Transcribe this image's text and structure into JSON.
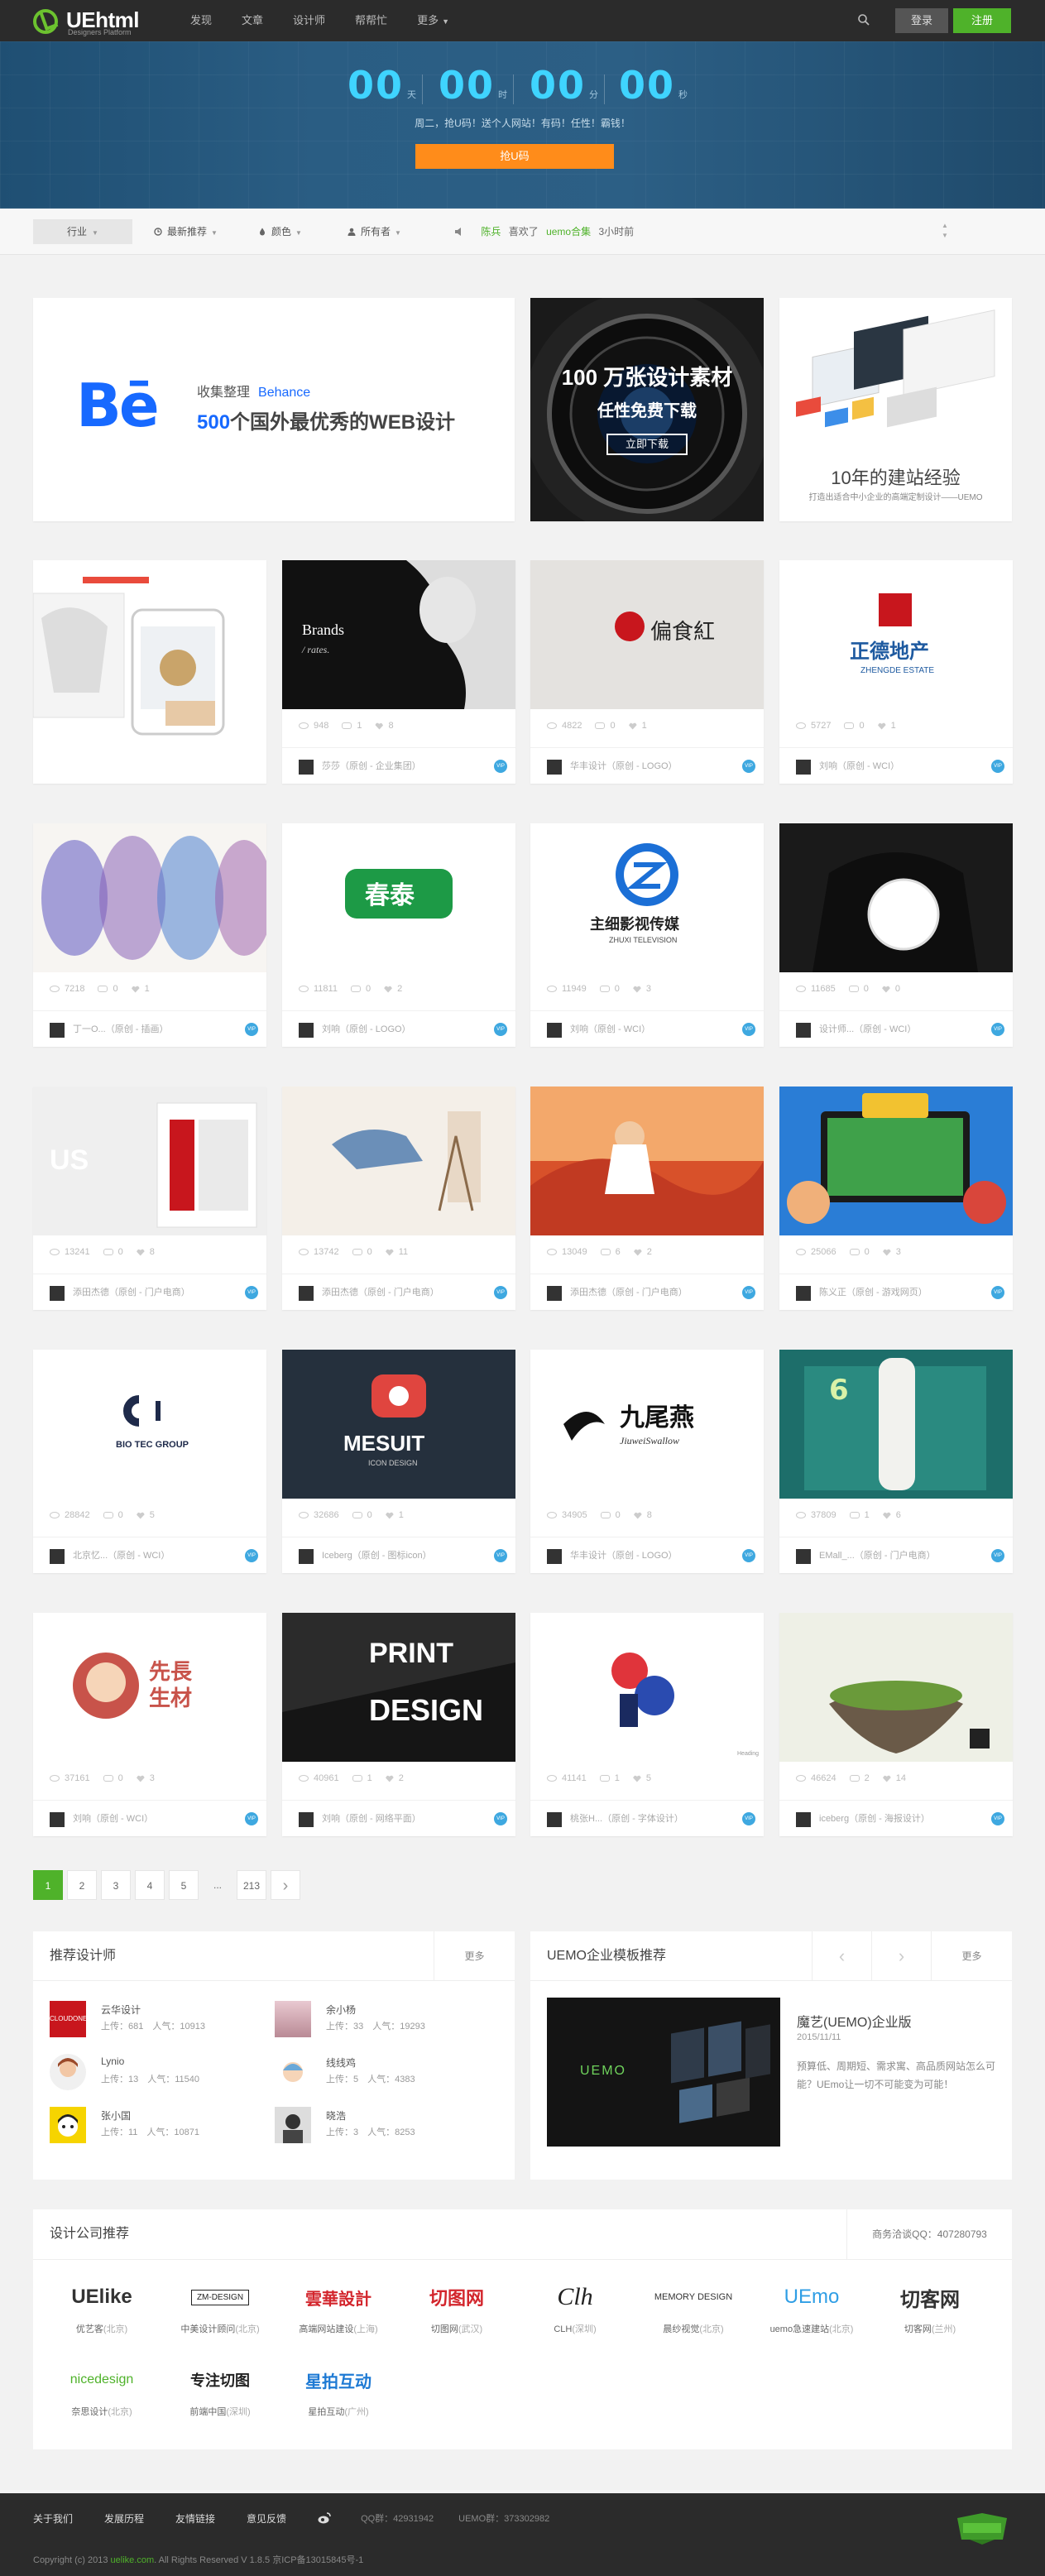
{
  "header": {
    "logo_name": "UEhtml",
    "logo_sub": "Designers Platform",
    "nav": [
      "发现",
      "文章",
      "设计师",
      "帮帮忙",
      "更多"
    ],
    "login": "登录",
    "register": "注册"
  },
  "banner": {
    "countdown": [
      {
        "num": "00",
        "unit": "天"
      },
      {
        "num": "00",
        "unit": "时"
      },
      {
        "num": "00",
        "unit": "分"
      },
      {
        "num": "00",
        "unit": "秒"
      }
    ],
    "tagline": "周二，抢U码！送个人网站！有码！任性！霸钱！",
    "button": "抢U码"
  },
  "filter": {
    "trade": "行业",
    "items": [
      "最新推荐",
      "颜色",
      "所有者"
    ],
    "news_user": "陈兵",
    "news_action": "喜欢了",
    "news_target": "uemo合集",
    "news_time": "3小时前"
  },
  "features": {
    "behance_label": "收集整理",
    "behance_brand": "Behance",
    "behance_num": "500",
    "behance_title": "个国外最优秀的WEB设计",
    "lens_title": "100 万张设计素材",
    "lens_sub": "任性免费下载",
    "lens_btn": "立即下载",
    "site_title": "10年的建站经验",
    "site_sub": "打造出适合中小企业的高端定制设计——UEMO"
  },
  "cards": [
    {
      "views": "948",
      "comments": "1",
      "likes": "8",
      "author": "莎莎（原创 - 企业集团）",
      "thumb": "Brands"
    },
    {
      "views": "4822",
      "comments": "0",
      "likes": "1",
      "author": "华丰设计（原创 - LOGO）",
      "thumb": "偏食紅"
    },
    {
      "views": "5727",
      "comments": "0",
      "likes": "1",
      "author": "刘响（原创 - WCI）",
      "thumb": "正德地产"
    },
    {
      "views": "7218",
      "comments": "0",
      "likes": "1",
      "author": "丁一O...（原创 - 插画）",
      "thumb": "sketch"
    },
    {
      "views": "11811",
      "comments": "0",
      "likes": "2",
      "author": "刘响（原创 - LOGO）",
      "thumb": "春泰"
    },
    {
      "views": "11949",
      "comments": "0",
      "likes": "3",
      "author": "刘响（原创 - WCI）",
      "thumb": "主细影视传媒"
    },
    {
      "views": "11685",
      "comments": "0",
      "likes": "0",
      "author": "设计师...（原创 - WCI）",
      "thumb": "plate"
    },
    {
      "views": "13241",
      "comments": "0",
      "likes": "8",
      "author": "添田杰德（原创 - 门户电商）",
      "thumb": "store"
    },
    {
      "views": "13742",
      "comments": "0",
      "likes": "11",
      "author": "添田杰德（原创 - 门户电商）",
      "thumb": "float"
    },
    {
      "views": "13049",
      "comments": "6",
      "likes": "2",
      "author": "添田杰德（原创 - 门户电商）",
      "thumb": "fantasy"
    },
    {
      "views": "25066",
      "comments": "0",
      "likes": "3",
      "author": "陈义正（原创 - 游戏网页）",
      "thumb": "clash"
    },
    {
      "views": "28842",
      "comments": "0",
      "likes": "5",
      "author": "北京忆...（原创 - WCI）",
      "thumb": "BIO TEC GROUP"
    },
    {
      "views": "32686",
      "comments": "0",
      "likes": "1",
      "author": "Iceberg（原创 - 图标icon）",
      "thumb": "MESUIT"
    },
    {
      "views": "34905",
      "comments": "0",
      "likes": "8",
      "author": "华丰设计（原创 - LOGO）",
      "thumb": "九尾燕"
    },
    {
      "views": "37809",
      "comments": "1",
      "likes": "6",
      "author": "EMall_...（原创 - 门户电商）",
      "thumb": "bottle"
    },
    {
      "views": "37161",
      "comments": "0",
      "likes": "3",
      "author": "刘响（原创 - WCI）",
      "thumb": "先長生材"
    },
    {
      "views": "40961",
      "comments": "1",
      "likes": "2",
      "author": "刘响（原创 - 网络平面）",
      "thumb": "PRINT DESIGN"
    },
    {
      "views": "41141",
      "comments": "1",
      "likes": "5",
      "author": "桃张H...（原创 - 字体设计）",
      "thumb": "Heading"
    },
    {
      "views": "46624",
      "comments": "2",
      "likes": "14",
      "author": "iceberg（原创 - 海报设计）",
      "thumb": "island"
    }
  ],
  "pager": [
    "1",
    "2",
    "3",
    "4",
    "5",
    "...",
    "213",
    "›"
  ],
  "designers": {
    "title": "推荐设计师",
    "more": "更多",
    "list": [
      {
        "name": "云华设计",
        "stats": "上传：681　人气：10913"
      },
      {
        "name": "余小杨",
        "stats": "上传：33　人气：19293"
      },
      {
        "name": "Lynio",
        "stats": "上传：13　人气：11540"
      },
      {
        "name": "线线鸡",
        "stats": "上传：5　人气：4383"
      },
      {
        "name": "张小国",
        "stats": "上传：11　人气：10871"
      },
      {
        "name": "晓浩",
        "stats": "上传：3　人气：8253"
      }
    ]
  },
  "templates": {
    "title": "UEMO企业模板推荐",
    "more": "更多",
    "item_title": "魔艺(UEMO)企业版",
    "item_date": "2015/11/11",
    "item_desc": "预算低、周期短、需求寓、高品质网站怎么可能？UEmo让一切不可能变为可能！",
    "thumb_text": "UEMO"
  },
  "companies": {
    "title": "设计公司推荐",
    "qq": "商务洽谈QQ：407280793",
    "list": [
      {
        "logo": "UElike",
        "name": "优艺客",
        "city": "(北京)"
      },
      {
        "logo": "ZM-DESIGN",
        "name": "中美设计顾问",
        "city": "(北京)"
      },
      {
        "logo": "雲華設計",
        "name": "高端网站建设",
        "city": "(上海)"
      },
      {
        "logo": "切图网",
        "name": "切图网",
        "city": "(武汉)"
      },
      {
        "logo": "Clh",
        "name": "CLH",
        "city": "(深圳)"
      },
      {
        "logo": "MEMORY DESIGN",
        "name": "晨纱视觉",
        "city": "(北京)"
      },
      {
        "logo": "UEmo",
        "name": "uemo急速建站",
        "city": "(北京)"
      },
      {
        "logo": "切客网",
        "name": "切客网",
        "city": "(兰州)"
      },
      {
        "logo": "nicedesign",
        "name": "奈思设计",
        "city": "(北京)"
      },
      {
        "logo": "专注切图",
        "name": "前端中国",
        "city": "(深圳)"
      },
      {
        "logo": "星拍互动",
        "name": "星拍互动",
        "city": "(广州)"
      }
    ]
  },
  "footer": {
    "links": [
      "关于我们",
      "发展历程",
      "友情链接",
      "意见反馈"
    ],
    "qq1": "QQ群：42931942",
    "qq2": "UEMO群：373302982",
    "copy_pre": "Copyright (c) 2013 ",
    "copy_site": "uelike.com",
    "copy_post": ". All Rights Reserved V 1.8.5 京ICP备13015845号-1"
  },
  "colors": {
    "brand": "#4fb22a",
    "accent": "#ff8c1a",
    "countdown": "#3fd4ff",
    "vip": "#3ea8e0"
  }
}
